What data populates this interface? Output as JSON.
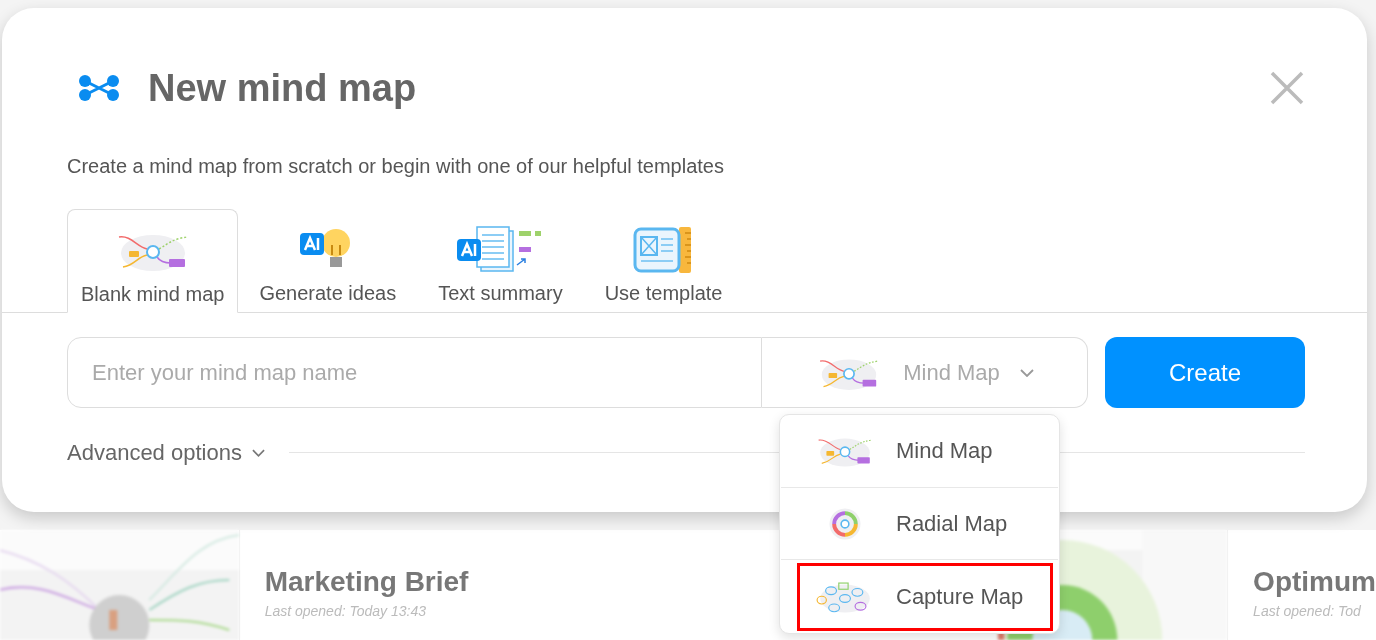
{
  "background_cards": [
    {
      "kind": "picture"
    },
    {
      "kind": "document",
      "title": "Marketing Brief",
      "subtitle": "Last opened: Today 13:43"
    },
    {
      "kind": "picture"
    },
    {
      "kind": "document",
      "title": "Optimum",
      "subtitle": "Last opened: Tod"
    }
  ],
  "dialog": {
    "title": "New mind map",
    "subtitle": "Create a mind map from scratch or begin with one of our helpful templates",
    "tabs": [
      {
        "label": "Blank mind map",
        "kind": "blank",
        "selected": true
      },
      {
        "label": "Generate ideas",
        "kind": "ideas",
        "selected": false
      },
      {
        "label": "Text summary",
        "kind": "summary",
        "selected": false
      },
      {
        "label": "Use template",
        "kind": "template",
        "selected": false
      }
    ],
    "name_field": {
      "placeholder": "Enter your mind map name"
    },
    "map_type": {
      "value": "Mind Map",
      "kind": "mind",
      "expanded": true
    },
    "create_button": "Create",
    "advanced_options": "Advanced options",
    "map_type_options": [
      {
        "label": "Mind Map",
        "kind": "mind",
        "highlighted": false
      },
      {
        "label": "Radial Map",
        "kind": "radial",
        "highlighted": false
      },
      {
        "label": "Capture Map",
        "kind": "capture",
        "highlighted": true
      }
    ]
  }
}
